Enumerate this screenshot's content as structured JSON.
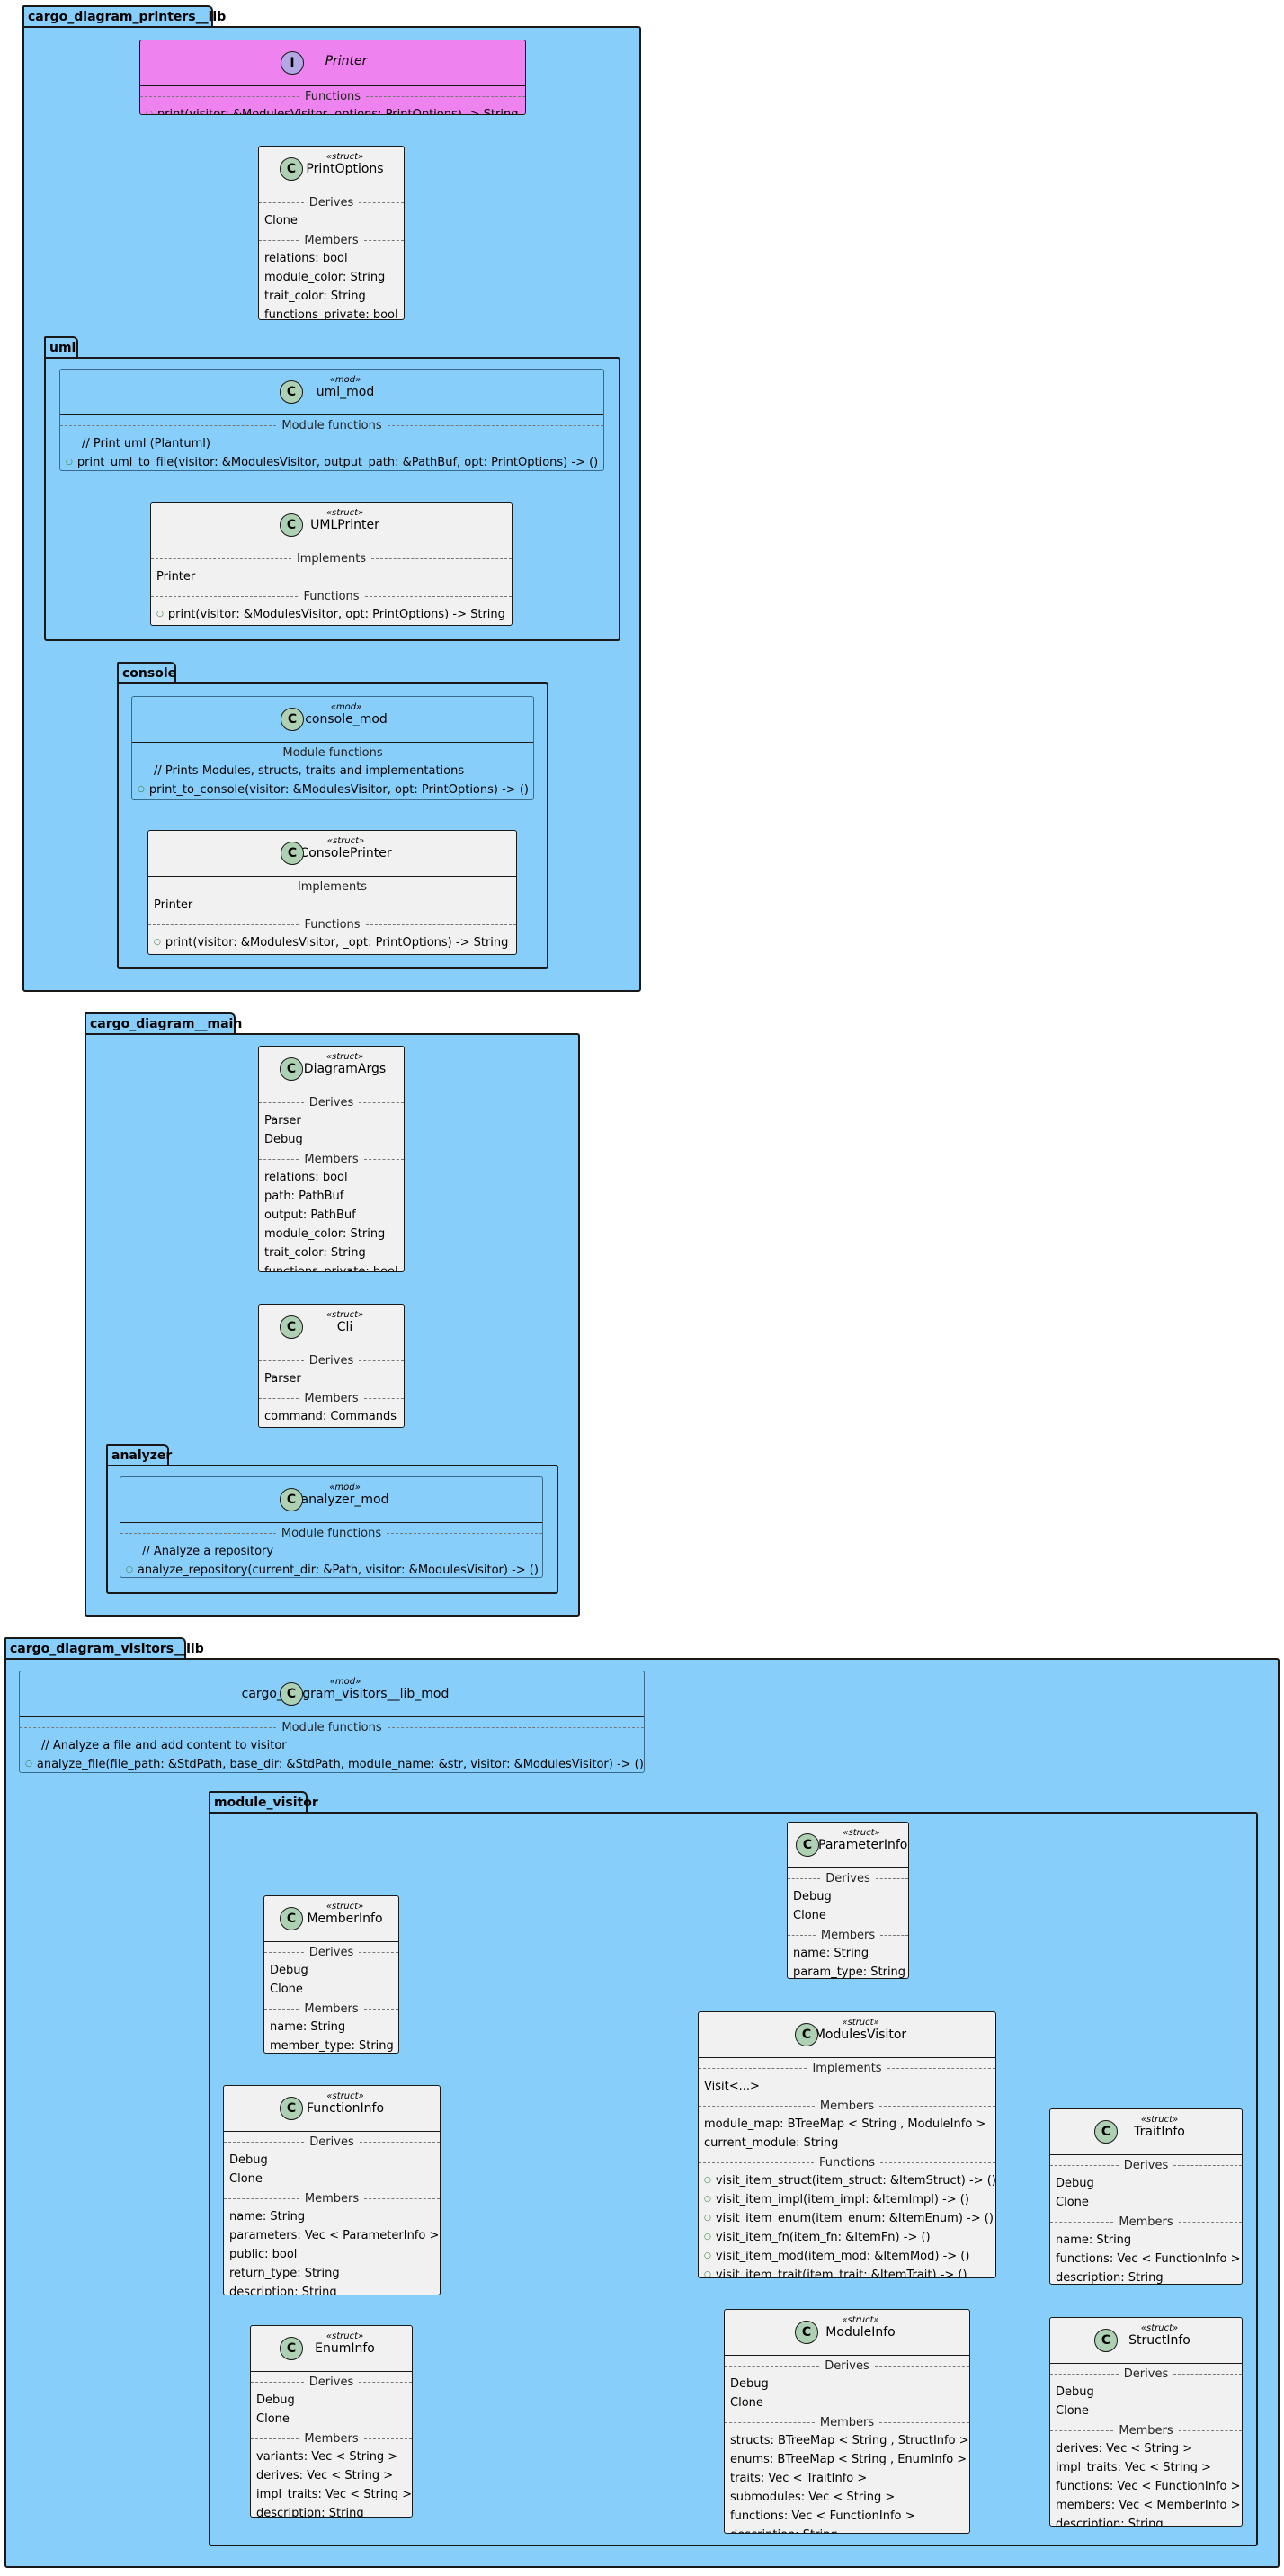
{
  "packages": {
    "printers": "cargo_diagram_printers__lib",
    "uml": "uml",
    "console": "console",
    "main": "cargo_diagram__main",
    "analyzer": "analyzer",
    "visitors": "cargo_diagram_visitors__lib",
    "module_visitor": "module_visitor"
  },
  "labels": {
    "functions": "Functions",
    "derives": "Derives",
    "members": "Members",
    "implements": "Implements",
    "module_functions": "Module functions",
    "struct": "«struct»",
    "mod": "«mod»"
  },
  "printer": {
    "name": "Printer",
    "functions": [
      "print(visitor: &ModulesVisitor, options: PrintOptions) -> String"
    ]
  },
  "print_options": {
    "name": "PrintOptions",
    "derives": [
      "Clone"
    ],
    "members": [
      "relations: bool",
      "module_color: String",
      "trait_color: String",
      "functions_private: bool"
    ]
  },
  "uml_mod": {
    "name": "uml_mod",
    "comment": "//  Print uml (Plantuml)",
    "functions": [
      "print_uml_to_file(visitor: &ModulesVisitor, output_path: &PathBuf, opt: PrintOptions) -> ()"
    ]
  },
  "uml_printer": {
    "name": "UMLPrinter",
    "implements": [
      "Printer"
    ],
    "functions": [
      "print(visitor: &ModulesVisitor, opt: PrintOptions) -> String"
    ]
  },
  "console_mod": {
    "name": "console_mod",
    "comment": "//  Prints Modules, structs, traits and implementations",
    "functions": [
      "print_to_console(visitor: &ModulesVisitor, opt: PrintOptions) -> ()"
    ]
  },
  "console_printer": {
    "name": "ConsolePrinter",
    "implements": [
      "Printer"
    ],
    "functions": [
      "print(visitor: &ModulesVisitor, _opt: PrintOptions) -> String"
    ]
  },
  "diagram_args": {
    "name": "DiagramArgs",
    "derives": [
      "Parser",
      "Debug"
    ],
    "members": [
      "relations: bool",
      "path: PathBuf",
      "output: PathBuf",
      "module_color: String",
      "trait_color: String",
      "functions_private: bool"
    ]
  },
  "cli": {
    "name": "Cli",
    "derives": [
      "Parser"
    ],
    "members": [
      "command: Commands"
    ]
  },
  "analyzer_mod": {
    "name": "analyzer_mod",
    "comment": "//  Analyze a repository",
    "functions": [
      "analyze_repository(current_dir: &Path, visitor: &ModulesVisitor) -> ()"
    ]
  },
  "visitors_lib_mod": {
    "name": "cargo_diagram_visitors__lib_mod",
    "comment": "//  Analyze a file and add content to visitor",
    "functions": [
      "analyze_file(file_path: &StdPath, base_dir: &StdPath, module_name: &str, visitor: &ModulesVisitor) -> ()"
    ]
  },
  "parameter_info": {
    "name": "ParameterInfo",
    "derives": [
      "Debug",
      "Clone"
    ],
    "members": [
      "name: String",
      "param_type: String"
    ]
  },
  "member_info": {
    "name": "MemberInfo",
    "derives": [
      "Debug",
      "Clone"
    ],
    "members": [
      "name: String",
      "member_type: String"
    ]
  },
  "modules_visitor": {
    "name": "ModulesVisitor",
    "implements": [
      "Visit<...>"
    ],
    "members": [
      "module_map: BTreeMap < String , ModuleInfo >",
      "current_module: String"
    ],
    "functions": [
      "visit_item_struct(item_struct: &ItemStruct) -> ()",
      "visit_item_impl(item_impl: &ItemImpl) -> ()",
      "visit_item_enum(item_enum: &ItemEnum) -> ()",
      "visit_item_fn(item_fn: &ItemFn) -> ()",
      "visit_item_mod(item_mod: &ItemMod) -> ()",
      "visit_item_trait(item_trait: &ItemTrait) -> ()"
    ]
  },
  "function_info": {
    "name": "FunctionInfo",
    "derives": [
      "Debug",
      "Clone"
    ],
    "members": [
      "name: String",
      "parameters: Vec < ParameterInfo >",
      "public: bool",
      "return_type: String",
      "description: String"
    ]
  },
  "trait_info": {
    "name": "TraitInfo",
    "derives": [
      "Debug",
      "Clone"
    ],
    "members": [
      "name: String",
      "functions: Vec < FunctionInfo >",
      "description: String"
    ]
  },
  "enum_info": {
    "name": "EnumInfo",
    "derives": [
      "Debug",
      "Clone"
    ],
    "members": [
      "variants: Vec < String >",
      "derives: Vec < String >",
      "impl_traits: Vec < String >",
      "description: String"
    ]
  },
  "module_info": {
    "name": "ModuleInfo",
    "derives": [
      "Debug",
      "Clone"
    ],
    "members": [
      "structs: BTreeMap < String , StructInfo >",
      "enums: BTreeMap < String , EnumInfo >",
      "traits: Vec < TraitInfo >",
      "submodules: Vec < String >",
      "functions: Vec < FunctionInfo >",
      "description: String"
    ]
  },
  "struct_info": {
    "name": "StructInfo",
    "derives": [
      "Debug",
      "Clone"
    ],
    "members": [
      "derives: Vec < String >",
      "impl_traits: Vec < String >",
      "functions: Vec < FunctionInfo >",
      "members: Vec < MemberInfo >",
      "description: String"
    ]
  },
  "colors": {
    "package": "#87CEFA",
    "class": "#F1F1F1",
    "interface": "#EE82EE",
    "class_circle": "#ADD1B2",
    "interface_circle": "#B4A7E5"
  }
}
